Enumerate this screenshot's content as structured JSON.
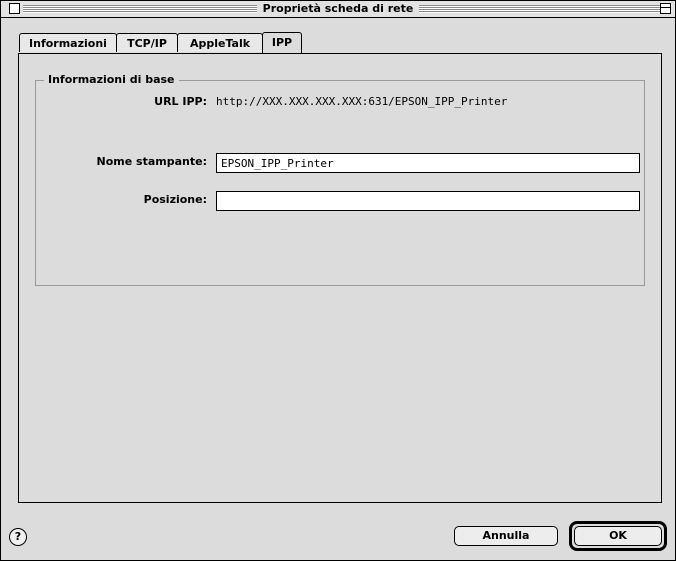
{
  "window": {
    "title": "Proprietà scheda di rete"
  },
  "tabs": [
    {
      "label": "Informazioni"
    },
    {
      "label": "TCP/IP"
    },
    {
      "label": "AppleTalk"
    },
    {
      "label": "IPP",
      "active": true
    }
  ],
  "group": {
    "title": "Informazioni di base",
    "url_label": "URL IPP:",
    "url_value": "http://XXX.XXX.XXX.XXX:631/EPSON_IPP_Printer",
    "printer_name_label": "Nome stampante:",
    "printer_name_value": "EPSON_IPP_Printer",
    "location_label": "Posizione:",
    "location_value": ""
  },
  "buttons": {
    "help": "?",
    "cancel": "Annulla",
    "ok": "OK"
  }
}
